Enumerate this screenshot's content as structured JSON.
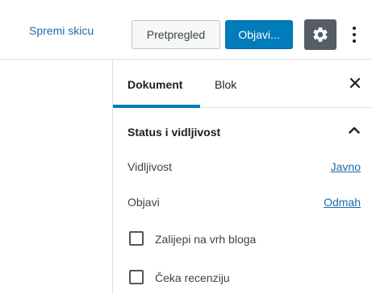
{
  "toolbar": {
    "save_draft_label": "Spremi skicu",
    "preview_label": "Pretpregled",
    "publish_label": "Objavi...",
    "settings_icon": "gear-icon",
    "more_icon": "vertical-ellipsis-icon",
    "accent_color": "#007cba"
  },
  "sidebar": {
    "tabs": [
      {
        "label": "Dokument",
        "active": true
      },
      {
        "label": "Blok",
        "active": false
      }
    ],
    "close_icon": "close-icon",
    "panel": {
      "title": "Status i vidljivost",
      "expanded": true,
      "rows": [
        {
          "label": "Vidljivost",
          "value": "Javno"
        },
        {
          "label": "Objavi",
          "value": "Odmah"
        }
      ],
      "checkboxes": [
        {
          "label": "Zalijepi na vrh bloga",
          "checked": false
        },
        {
          "label": "Čeka recenziju",
          "checked": false
        }
      ]
    }
  }
}
